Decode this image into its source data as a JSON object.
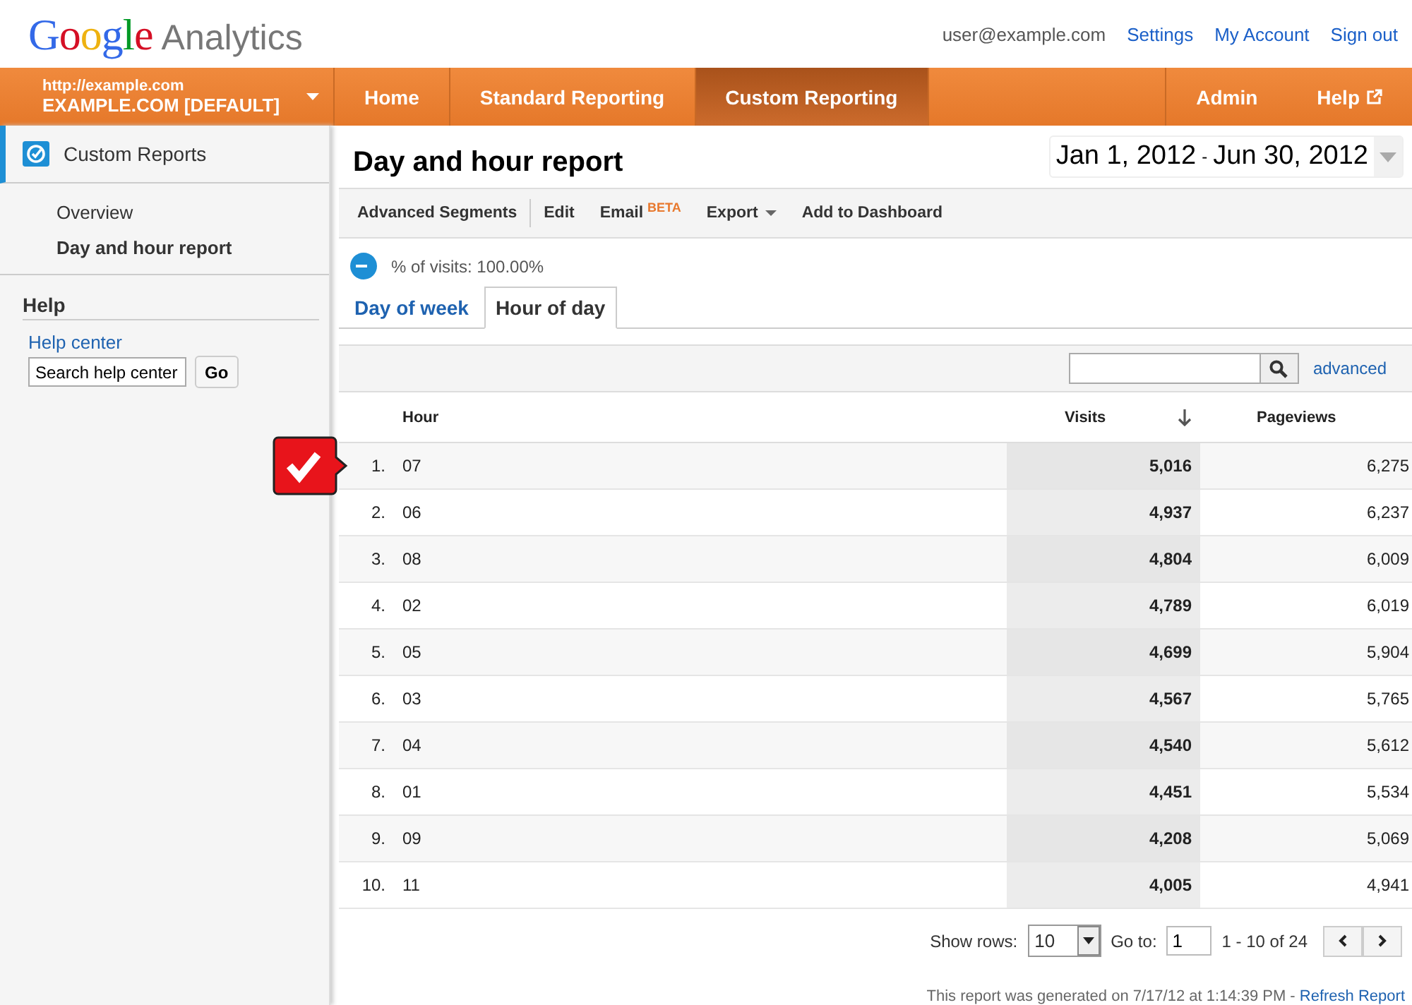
{
  "header": {
    "logo": {
      "brand": "Google",
      "product": "Analytics"
    },
    "user": "user@example.com",
    "links": [
      "Settings",
      "My Account",
      "Sign out"
    ]
  },
  "nav": {
    "account": {
      "url": "http://example.com",
      "name": "EXAMPLE.COM [DEFAULT]"
    },
    "tabs": [
      {
        "label": "Home",
        "selected": false
      },
      {
        "label": "Standard Reporting",
        "selected": false
      },
      {
        "label": "Custom Reporting",
        "selected": true
      }
    ],
    "right": [
      {
        "label": "Admin",
        "external": false
      },
      {
        "label": "Help",
        "external": true
      }
    ]
  },
  "sidebar": {
    "section": "Custom Reports",
    "items": [
      {
        "label": "Overview",
        "selected": false
      },
      {
        "label": "Day and hour report",
        "selected": true
      }
    ],
    "help": {
      "title": "Help",
      "link": "Help center",
      "search_value": "Search help center",
      "button": "Go"
    }
  },
  "report": {
    "title": "Day and hour report",
    "date_start": "Jan 1, 2012",
    "date_sep": "-",
    "date_end": "Jun 30, 2012",
    "toolbar": [
      {
        "label": "Advanced Segments",
        "kind": "plain"
      },
      {
        "label": "Edit",
        "kind": "plain"
      },
      {
        "label": "Email",
        "kind": "badge",
        "badge": "BETA"
      },
      {
        "label": "Export",
        "kind": "menu"
      },
      {
        "label": "Add to Dashboard",
        "kind": "plain"
      }
    ],
    "segment": "% of visits: 100.00%",
    "tabs": [
      {
        "label": "Day of week",
        "selected": false
      },
      {
        "label": "Hour of day",
        "selected": true
      }
    ],
    "advanced": "advanced",
    "columns": [
      "Hour",
      "Visits",
      "Pageviews"
    ],
    "rows": [
      {
        "n": "1.",
        "hour": "07",
        "visits": "5,016",
        "pageviews": "6,275",
        "flagged": true
      },
      {
        "n": "2.",
        "hour": "06",
        "visits": "4,937",
        "pageviews": "6,237",
        "flagged": false
      },
      {
        "n": "3.",
        "hour": "08",
        "visits": "4,804",
        "pageviews": "6,009",
        "flagged": false
      },
      {
        "n": "4.",
        "hour": "02",
        "visits": "4,789",
        "pageviews": "6,019",
        "flagged": false
      },
      {
        "n": "5.",
        "hour": "05",
        "visits": "4,699",
        "pageviews": "5,904",
        "flagged": false
      },
      {
        "n": "6.",
        "hour": "03",
        "visits": "4,567",
        "pageviews": "5,765",
        "flagged": false
      },
      {
        "n": "7.",
        "hour": "04",
        "visits": "4,540",
        "pageviews": "5,612",
        "flagged": false
      },
      {
        "n": "8.",
        "hour": "01",
        "visits": "4,451",
        "pageviews": "5,534",
        "flagged": false
      },
      {
        "n": "9.",
        "hour": "09",
        "visits": "4,208",
        "pageviews": "5,069",
        "flagged": false
      },
      {
        "n": "10.",
        "hour": "11",
        "visits": "4,005",
        "pageviews": "4,941",
        "flagged": false
      }
    ],
    "pager": {
      "show_rows_label": "Show rows:",
      "show_rows": "10",
      "goto_label": "Go to:",
      "goto": "1",
      "range": "1 - 10 of 24"
    },
    "footer": {
      "text": "This report was generated on 7/17/12 at 1:14:39 PM - ",
      "link": "Refresh Report"
    }
  }
}
